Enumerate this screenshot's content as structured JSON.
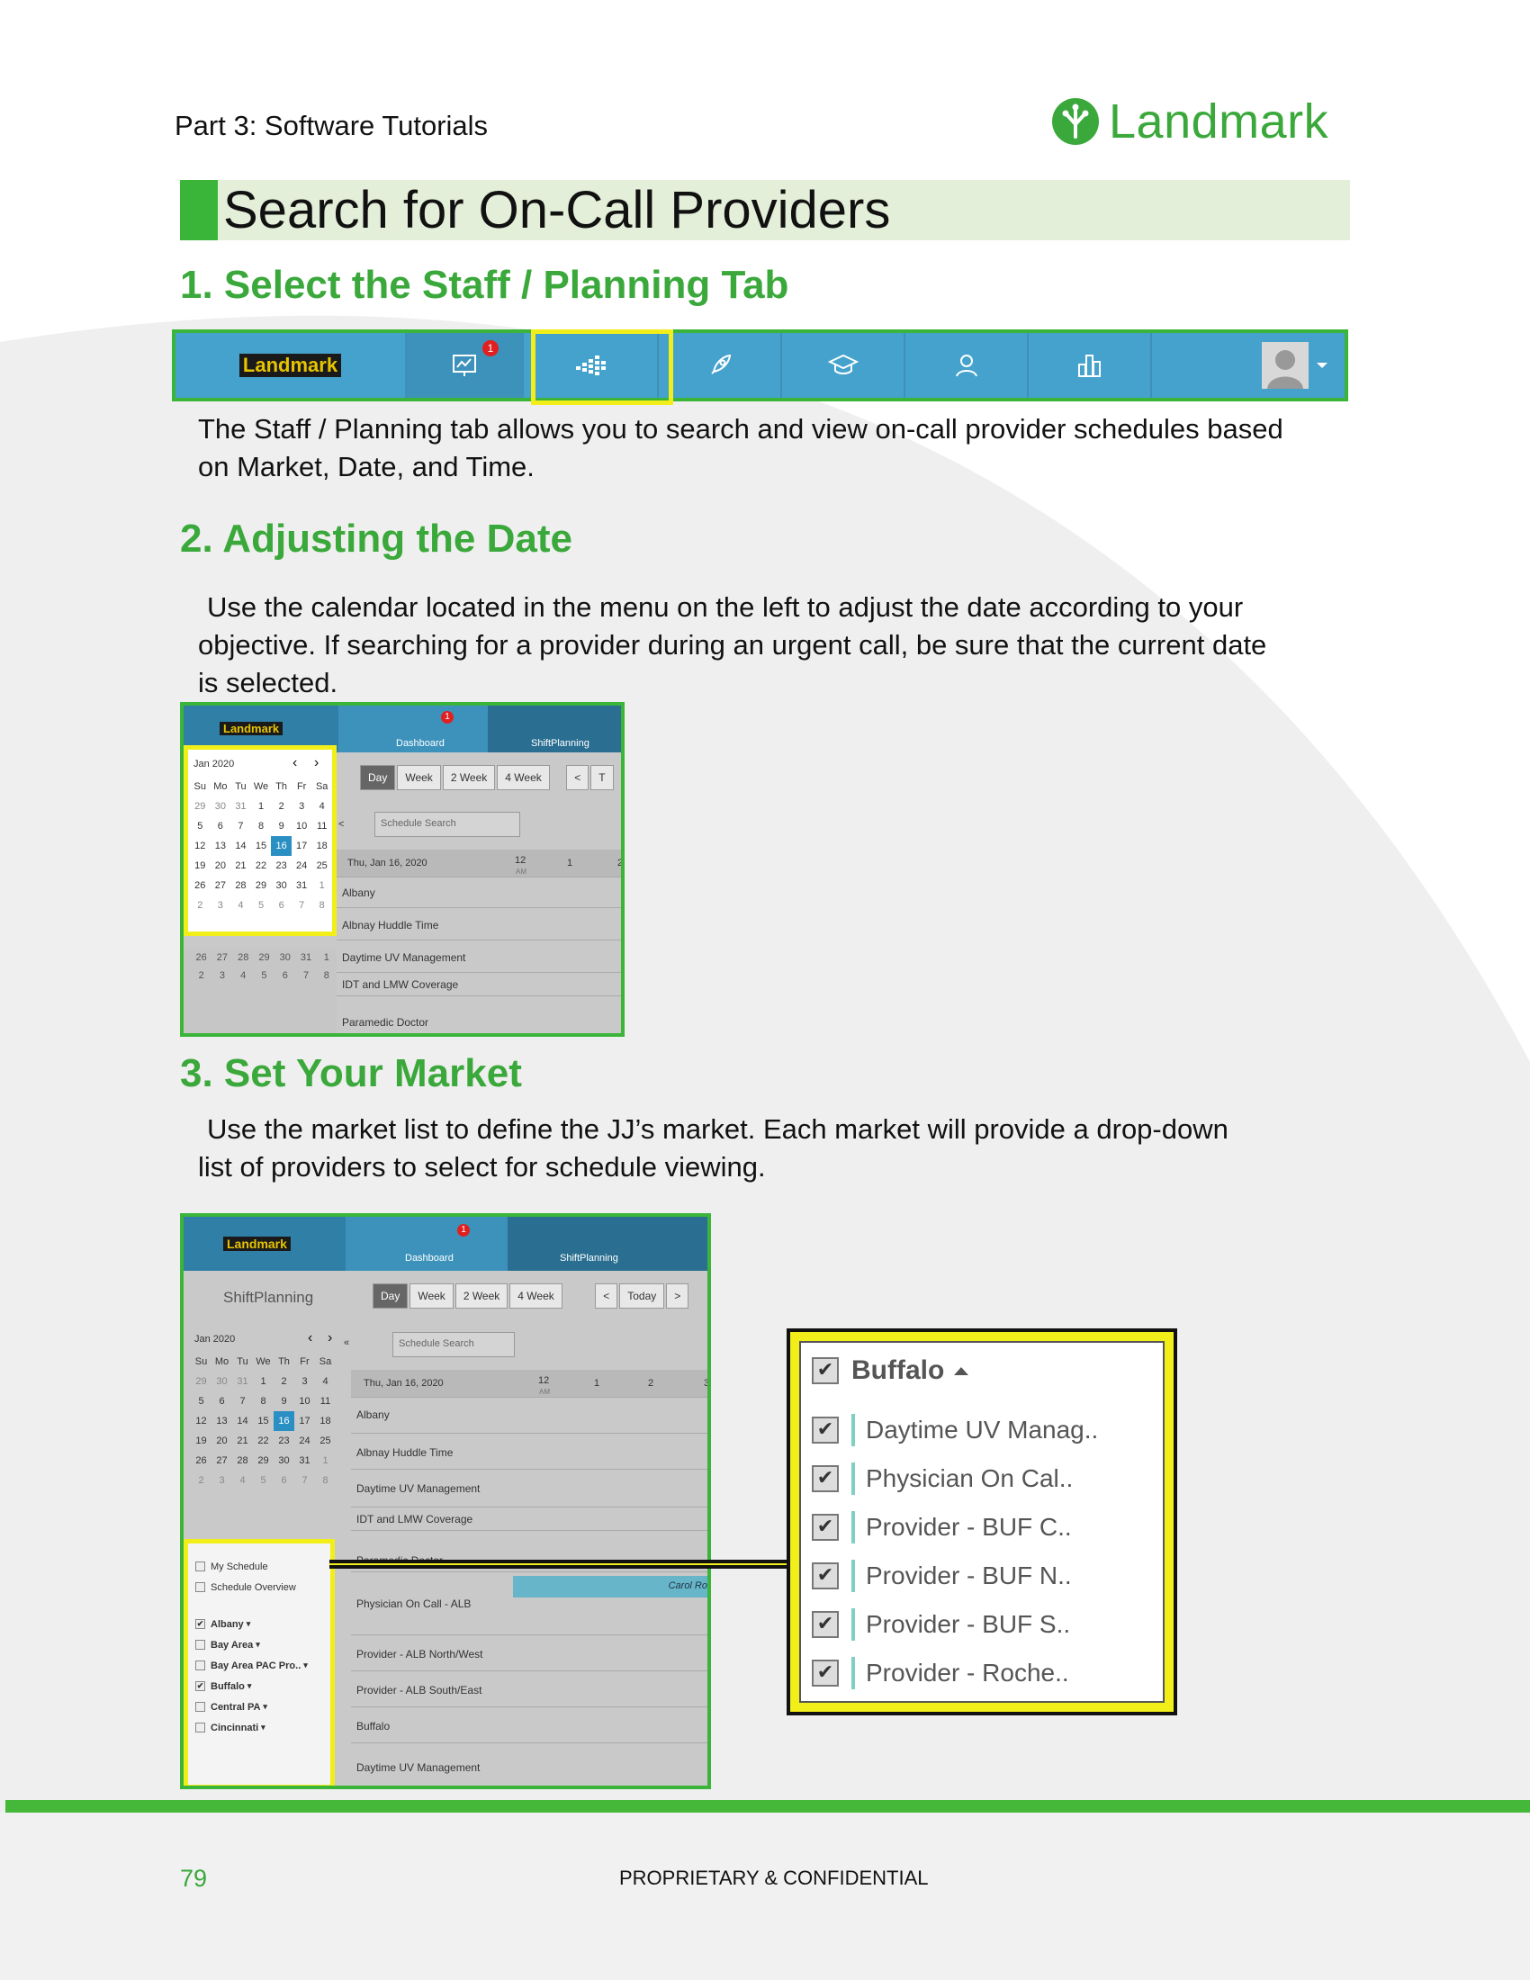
{
  "header": {
    "part_label": "Part 3: Software Tutorials",
    "logo_text": "Landmark"
  },
  "title": "Search for On-Call Providers",
  "sections": [
    {
      "heading": "1. Select the Staff / Planning Tab",
      "body": "The Staff / Planning tab allows you to search and view on-call provider schedules based on Market, Date, and Time."
    },
    {
      "heading": "2. Adjusting the Date",
      "body": "Use the calendar located in the menu on the left to adjust the date according to your objective. If searching for a provider during an urgent call, be sure that the current date is selected."
    },
    {
      "heading": "3. Set Your Market",
      "body": "Use the market list to define the JJ’s market. Each market will provide a drop-down list of providers to select for schedule viewing."
    }
  ],
  "navbar": {
    "logo": "Landmark",
    "badge": "1",
    "icons": [
      "dashboard-icon",
      "shift-planning-icon",
      "rocket-icon",
      "graduation-cap-icon",
      "user-icon",
      "bar-chart-icon",
      "avatar"
    ]
  },
  "mock": {
    "logo": "Landmark",
    "badge": "1",
    "tab_dashboard": "Dashboard",
    "tab_shift": "ShiftPlanning",
    "page_title": "ShiftPlanning",
    "view_buttons": [
      "Day",
      "Week",
      "2 Week",
      "4 Week"
    ],
    "prev": "<",
    "today": "Today",
    "next": ">",
    "next_short": "T",
    "collapse": "«",
    "collapse_single": "<",
    "month": "Jan 2020",
    "weekdays": [
      "Su",
      "Mo",
      "Tu",
      "We",
      "Th",
      "Fr",
      "Sa"
    ],
    "weeks": [
      [
        "29",
        "30",
        "31",
        "1",
        "2",
        "3",
        "4"
      ],
      [
        "5",
        "6",
        "7",
        "8",
        "9",
        "10",
        "11"
      ],
      [
        "12",
        "13",
        "14",
        "15",
        "16",
        "17",
        "18"
      ],
      [
        "19",
        "20",
        "21",
        "22",
        "23",
        "24",
        "25"
      ],
      [
        "26",
        "27",
        "28",
        "29",
        "30",
        "31",
        "1"
      ],
      [
        "2",
        "3",
        "4",
        "5",
        "6",
        "7",
        "8"
      ]
    ],
    "under_week": [
      "26",
      "27",
      "28",
      "29",
      "30",
      "31",
      "1"
    ],
    "under_week2": [
      "2",
      "3",
      "4",
      "5",
      "6",
      "7",
      "8"
    ],
    "selected_day": "16",
    "search_placeholder": "Schedule Search",
    "date_header": "Thu, Jan 16, 2020",
    "hours": [
      "12",
      "1",
      "2"
    ],
    "hour_cut": "3",
    "am": "AM",
    "rows_small": [
      "Albany",
      "Albnay Huddle Time",
      "Daytime UV Management",
      "IDT and LMW Coverage",
      "Paramedic Doctor"
    ],
    "rows_large": [
      "Albany",
      "Albnay Huddle Time",
      "Daytime UV Management",
      "IDT and LMW Coverage",
      "Paramedic Doctor",
      "Physician On Call - ALB",
      "Provider - ALB North/West",
      "Provider - ALB South/East",
      "Buffalo",
      "Daytime UV Management"
    ],
    "event": "Carol Ro",
    "filters": [
      {
        "label": "My Schedule",
        "checked": false
      },
      {
        "label": "Schedule Overview",
        "checked": false
      },
      {
        "label": "Albany",
        "checked": true,
        "bold": true
      },
      {
        "label": "Bay Area",
        "checked": false,
        "bold": true
      },
      {
        "label": "Bay Area PAC Pro..",
        "checked": false,
        "bold": true
      },
      {
        "label": "Buffalo",
        "checked": true,
        "bold": true
      },
      {
        "label": "Central PA",
        "checked": false,
        "bold": true
      },
      {
        "label": "Cincinnati",
        "checked": false,
        "bold": true
      }
    ]
  },
  "callout": {
    "market": "Buffalo",
    "check": "✔",
    "providers": [
      "Daytime UV Manag..",
      "Physician On Cal..",
      "Provider - BUF C..",
      "Provider - BUF N..",
      "Provider - BUF S..",
      "Provider - Roche.."
    ]
  },
  "footer": {
    "page_number": "79",
    "confidential": "PROPRIETARY & CONFIDENTIAL"
  },
  "colors": {
    "accent_green": "#3ab53a",
    "highlight_yellow": "#f2ee1a",
    "nav_blue": "#45a2cc"
  }
}
